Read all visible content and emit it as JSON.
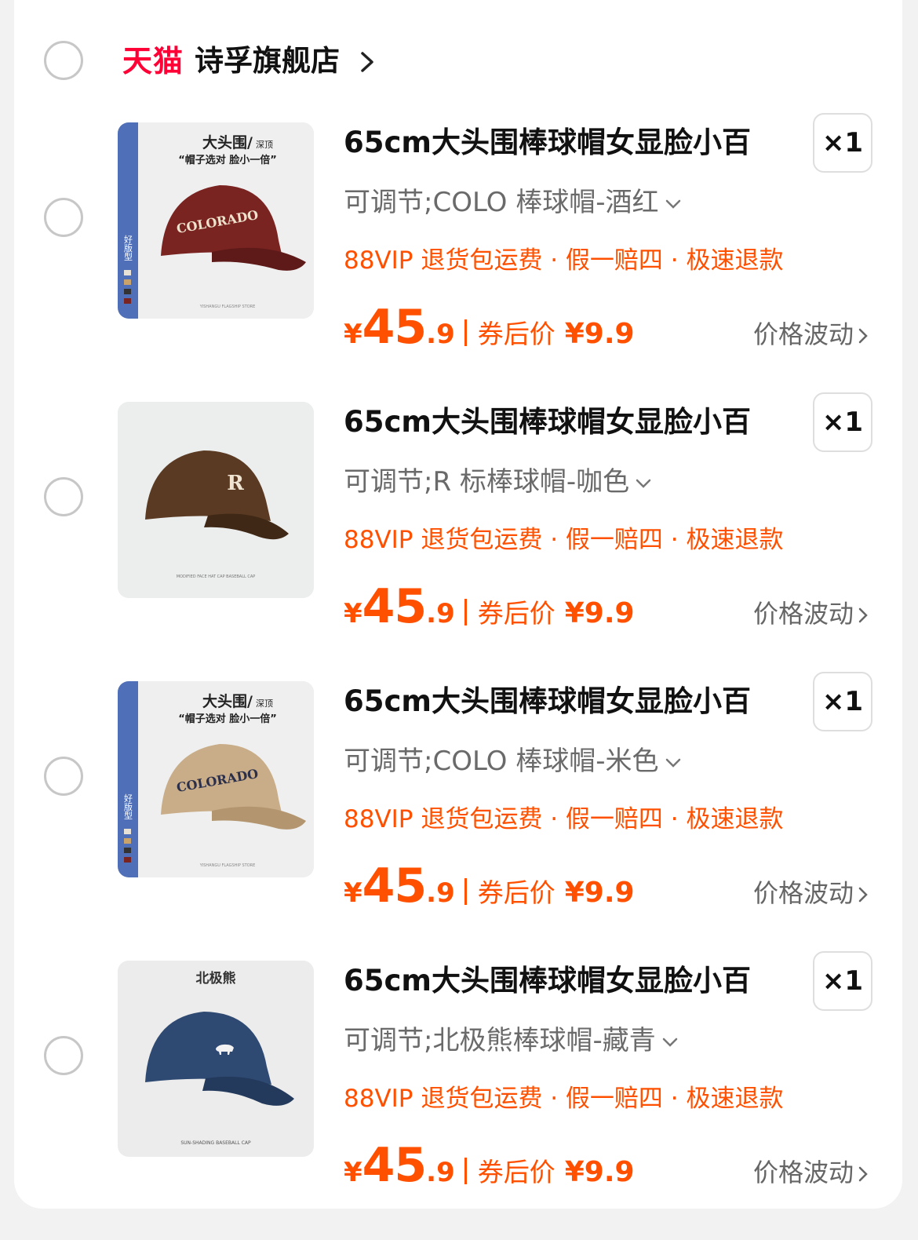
{
  "shop": {
    "platform": "天猫",
    "name": "诗孚旗舰店"
  },
  "items": [
    {
      "title": "65cm大头围棒球帽女显脸小百",
      "quantity": "×1",
      "spec": "可调节;COLO 棒球帽-酒红",
      "services": "88VIP 退货包运费 · 假一赔四 · 极速退款",
      "currency": "¥",
      "price_int": "45",
      "price_dec": ".9",
      "coupon_label": "券后价",
      "coupon_price": "¥9.9",
      "trend": "价格波动",
      "image": {
        "headline": "大头围/",
        "headline_small": "深顶",
        "subline": "“帽子选对 脸小一倍”",
        "side_label": "好版型",
        "logo_text": "COLORADO",
        "cap_color": "#7a2422",
        "footer_text": "YISHANGU FLAGSHIP STORE"
      }
    },
    {
      "title": "65cm大头围棒球帽女显脸小百",
      "quantity": "×1",
      "spec": "可调节;R 标棒球帽-咖色",
      "services": "88VIP 退货包运费 · 假一赔四 · 极速退款",
      "currency": "¥",
      "price_int": "45",
      "price_dec": ".9",
      "coupon_label": "券后价",
      "coupon_price": "¥9.9",
      "trend": "价格波动",
      "image": {
        "logo_text": "R",
        "cap_color": "#5a3a22",
        "footer_text": "MODIFIED FACE HAT CAP BASEBALL CAP"
      }
    },
    {
      "title": "65cm大头围棒球帽女显脸小百",
      "quantity": "×1",
      "spec": "可调节;COLO 棒球帽-米色",
      "services": "88VIP 退货包运费 · 假一赔四 · 极速退款",
      "currency": "¥",
      "price_int": "45",
      "price_dec": ".9",
      "coupon_label": "券后价",
      "coupon_price": "¥9.9",
      "trend": "价格波动",
      "image": {
        "headline": "大头围/",
        "headline_small": "深顶",
        "subline": "“帽子选对 脸小一倍”",
        "side_label": "好版型",
        "logo_text": "COLORADO",
        "cap_color": "#c9ad88",
        "footer_text": "YISHANGU FLAGSHIP STORE"
      }
    },
    {
      "title": "65cm大头围棒球帽女显脸小百",
      "quantity": "×1",
      "spec": "可调节;北极熊棒球帽-藏青",
      "services": "88VIP 退货包运费 · 假一赔四 · 极速退款",
      "currency": "¥",
      "price_int": "45",
      "price_dec": ".9",
      "coupon_label": "券后价",
      "coupon_price": "¥9.9",
      "trend": "价格波动",
      "image": {
        "headline": "北极熊",
        "logo_text": "polar-bear-logo",
        "cap_color": "#2f4a72",
        "footer_text": "SUN-SHADING BASEBALL CAP"
      }
    }
  ],
  "colors": {
    "accent": "#ff5000",
    "tmall": "#ff0036"
  }
}
